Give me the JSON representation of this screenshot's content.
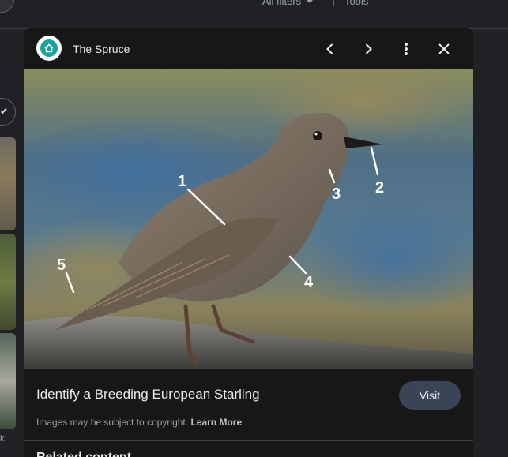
{
  "topbar": {
    "filters_label": "All filters",
    "tools_label": "Tools"
  },
  "left_label": "k",
  "panel": {
    "source_name": "The Spruce",
    "image_labels": [
      "1",
      "2",
      "3",
      "4",
      "5"
    ],
    "caption": "Identify a Breeding European Starling",
    "visit_label": "Visit",
    "copyright_text": "Images may be subject to copyright.",
    "learn_more": "Learn More",
    "related_heading": "Related content"
  },
  "icons": {
    "prev": "chevron-left-icon",
    "next": "chevron-right-icon",
    "more": "more-vert-icon",
    "close": "close-icon",
    "logo": "house-icon"
  },
  "colors": {
    "background": "#202124",
    "panel": "#171717",
    "visit_button": "#394457",
    "logo_accent": "#13a59c"
  }
}
